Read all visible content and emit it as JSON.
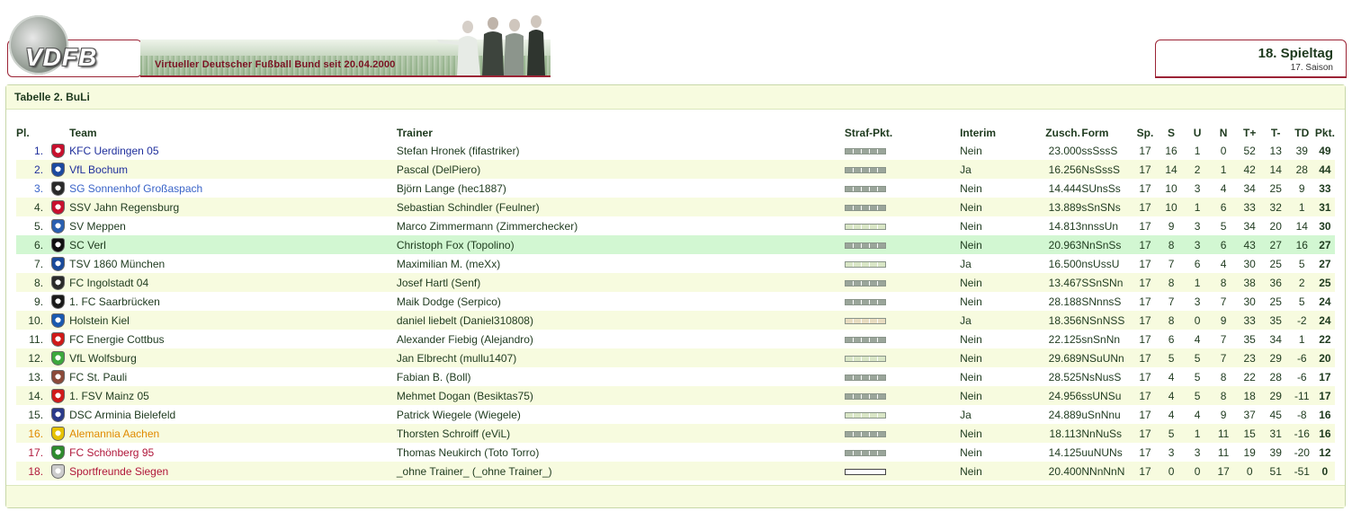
{
  "header": {
    "logo_text": "VDFB",
    "banner_text": "Virtueller Deutscher Fußball Bund seit 20.04.2000",
    "matchday": "18. Spieltag",
    "season": "17. Saison"
  },
  "panel": {
    "title": "Tabelle 2. BuLi"
  },
  "columns": {
    "pl": "Pl.",
    "team": "Team",
    "trainer": "Trainer",
    "straf": "Straf-Pkt.",
    "interim": "Interim",
    "zusch": "Zusch.",
    "form": "Form",
    "sp": "Sp.",
    "s": "S",
    "u": "U",
    "n": "N",
    "tplus": "T+",
    "tminus": "T-",
    "td": "TD",
    "pkt": "Pkt."
  },
  "rows": [
    {
      "pl": "1.",
      "team": "KFC Uerdingen 05",
      "trainer": "Stefan Hronek (fifastriker)",
      "interim": "Nein",
      "zusch": "23.000",
      "form": "ssSssS",
      "sp": "17",
      "s": "16",
      "u": "1",
      "n": "0",
      "tplus": "52",
      "tminus": "13",
      "td": "39",
      "pkt": "49"
    },
    {
      "pl": "2.",
      "team": "VfL Bochum",
      "trainer": "Pascal (DelPiero)",
      "interim": "Ja",
      "zusch": "16.256",
      "form": "NsSssS",
      "sp": "17",
      "s": "14",
      "u": "2",
      "n": "1",
      "tplus": "42",
      "tminus": "14",
      "td": "28",
      "pkt": "44"
    },
    {
      "pl": "3.",
      "team": "SG Sonnenhof Großaspach",
      "trainer": "Björn Lange (hec1887)",
      "interim": "Nein",
      "zusch": "14.444",
      "form": "SUnsSs",
      "sp": "17",
      "s": "10",
      "u": "3",
      "n": "4",
      "tplus": "34",
      "tminus": "25",
      "td": "9",
      "pkt": "33"
    },
    {
      "pl": "4.",
      "team": "SSV Jahn Regensburg",
      "trainer": "Sebastian Schindler (Feulner)",
      "interim": "Nein",
      "zusch": "13.889",
      "form": "sSnSNs",
      "sp": "17",
      "s": "10",
      "u": "1",
      "n": "6",
      "tplus": "33",
      "tminus": "32",
      "td": "1",
      "pkt": "31"
    },
    {
      "pl": "5.",
      "team": "SV Meppen",
      "trainer": "Marco Zimmermann (Zimmerchecker)",
      "interim": "Nein",
      "zusch": "14.813",
      "form": "nnssUn",
      "sp": "17",
      "s": "9",
      "u": "3",
      "n": "5",
      "tplus": "34",
      "tminus": "20",
      "td": "14",
      "pkt": "30"
    },
    {
      "pl": "6.",
      "team": "SC Verl",
      "trainer": "Christoph Fox (Topolino)",
      "interim": "Nein",
      "zusch": "20.963",
      "form": "NnSnSs",
      "sp": "17",
      "s": "8",
      "u": "3",
      "n": "6",
      "tplus": "43",
      "tminus": "27",
      "td": "16",
      "pkt": "27"
    },
    {
      "pl": "7.",
      "team": "TSV 1860 München",
      "trainer": "Maximilian M. (meXx)",
      "interim": "Ja",
      "zusch": "16.500",
      "form": "nsUssU",
      "sp": "17",
      "s": "7",
      "u": "6",
      "n": "4",
      "tplus": "30",
      "tminus": "25",
      "td": "5",
      "pkt": "27"
    },
    {
      "pl": "8.",
      "team": "FC Ingolstadt 04",
      "trainer": "Josef Hartl (Senf)",
      "interim": "Nein",
      "zusch": "13.467",
      "form": "SSnSNn",
      "sp": "17",
      "s": "8",
      "u": "1",
      "n": "8",
      "tplus": "38",
      "tminus": "36",
      "td": "2",
      "pkt": "25"
    },
    {
      "pl": "9.",
      "team": "1. FC Saarbrücken",
      "trainer": "Maik Dodge (Serpico)",
      "interim": "Nein",
      "zusch": "28.188",
      "form": "SNnnsS",
      "sp": "17",
      "s": "7",
      "u": "3",
      "n": "7",
      "tplus": "30",
      "tminus": "25",
      "td": "5",
      "pkt": "24"
    },
    {
      "pl": "10.",
      "team": "Holstein Kiel",
      "trainer": "daniel liebelt (Daniel310808)",
      "interim": "Ja",
      "zusch": "18.356",
      "form": "NSnNSS",
      "sp": "17",
      "s": "8",
      "u": "0",
      "n": "9",
      "tplus": "33",
      "tminus": "35",
      "td": "-2",
      "pkt": "24"
    },
    {
      "pl": "11.",
      "team": "FC Energie Cottbus",
      "trainer": "Alexander Fiebig (Alejandro)",
      "interim": "Nein",
      "zusch": "22.125",
      "form": "snSnNn",
      "sp": "17",
      "s": "6",
      "u": "4",
      "n": "7",
      "tplus": "35",
      "tminus": "34",
      "td": "1",
      "pkt": "22"
    },
    {
      "pl": "12.",
      "team": "VfL Wolfsburg",
      "trainer": "Jan Elbrecht (mullu1407)",
      "interim": "Nein",
      "zusch": "29.689",
      "form": "NSuUNn",
      "sp": "17",
      "s": "5",
      "u": "5",
      "n": "7",
      "tplus": "23",
      "tminus": "29",
      "td": "-6",
      "pkt": "20"
    },
    {
      "pl": "13.",
      "team": "FC St. Pauli",
      "trainer": "Fabian B. (Boll)",
      "interim": "Nein",
      "zusch": "28.525",
      "form": "NsNusS",
      "sp": "17",
      "s": "4",
      "u": "5",
      "n": "8",
      "tplus": "22",
      "tminus": "28",
      "td": "-6",
      "pkt": "17"
    },
    {
      "pl": "14.",
      "team": "1. FSV Mainz 05",
      "trainer": "Mehmet Dogan (Besiktas75)",
      "interim": "Nein",
      "zusch": "24.956",
      "form": "ssUNSu",
      "sp": "17",
      "s": "4",
      "u": "5",
      "n": "8",
      "tplus": "18",
      "tminus": "29",
      "td": "-11",
      "pkt": "17"
    },
    {
      "pl": "15.",
      "team": "DSC Arminia Bielefeld",
      "trainer": "Patrick Wiegele (Wiegele)",
      "interim": "Ja",
      "zusch": "24.889",
      "form": "uSnNnu",
      "sp": "17",
      "s": "4",
      "u": "4",
      "n": "9",
      "tplus": "37",
      "tminus": "45",
      "td": "-8",
      "pkt": "16"
    },
    {
      "pl": "16.",
      "team": "Alemannia Aachen",
      "trainer": "Thorsten Schroiff (eViL)",
      "interim": "Nein",
      "zusch": "18.113",
      "form": "NnNuSs",
      "sp": "17",
      "s": "5",
      "u": "1",
      "n": "11",
      "tplus": "15",
      "tminus": "31",
      "td": "-16",
      "pkt": "16"
    },
    {
      "pl": "17.",
      "team": "FC Schönberg 95",
      "trainer": "Thomas Neukirch (Toto Torro)",
      "interim": "Nein",
      "zusch": "14.125",
      "form": "uuNUNs",
      "sp": "17",
      "s": "3",
      "u": "3",
      "n": "11",
      "tplus": "19",
      "tminus": "39",
      "td": "-20",
      "pkt": "12"
    },
    {
      "pl": "18.",
      "team": "Sportfreunde Siegen",
      "trainer": "_ohne Trainer_ (_ohne Trainer_)",
      "interim": "Nein",
      "zusch": "20.400",
      "form": "NNnNnN",
      "sp": "17",
      "s": "0",
      "u": "0",
      "n": "17",
      "tplus": "0",
      "tminus": "51",
      "td": "-51",
      "pkt": "0"
    }
  ],
  "row_styles": {
    "team_colors": [
      "#1f2f9c",
      "#1f2f9c",
      "#3a64c8",
      "#1e3a1e",
      "#1e3a1e",
      "#1e3a1e",
      "#1e3a1e",
      "#1e3a1e",
      "#1e3a1e",
      "#1e3a1e",
      "#1e3a1e",
      "#1e3a1e",
      "#1e3a1e",
      "#1e3a1e",
      "#1e3a1e",
      "#e08a00",
      "#b0173a",
      "#b0173a"
    ],
    "highlight_row": 6,
    "crest_colors": [
      "#c8102e",
      "#1c4aa0",
      "#2a2a2a",
      "#c8102e",
      "#2a5fb0",
      "#111111",
      "#1a4a9a",
      "#2a2a2a",
      "#1a1a1a",
      "#1a5ab0",
      "#d01a1a",
      "#3da83d",
      "#8b4a3a",
      "#d01a1a",
      "#2a3a8a",
      "#e6c200",
      "#2e8b2e",
      "#cccccc"
    ],
    "straf_styles": [
      "",
      "",
      "",
      "",
      "light",
      "",
      "light",
      "",
      "",
      "warm",
      "",
      "light",
      "",
      "",
      "light",
      "",
      "",
      "empty"
    ]
  }
}
